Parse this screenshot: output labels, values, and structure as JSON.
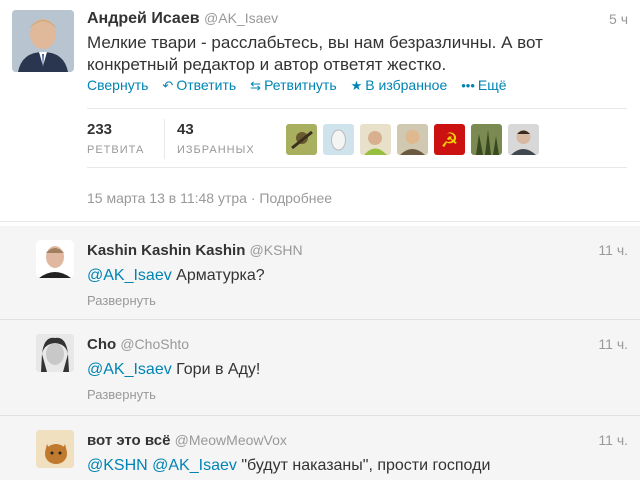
{
  "main_tweet": {
    "fullname": "Андрей Исаев",
    "username": "@AK_Isaev",
    "time": "5 ч",
    "text": "Мелкие твари - расслабьтесь, вы нам безразличны. А вот конкретный редактор и автор ответят жестко.",
    "actions": {
      "collapse": "Свернуть",
      "reply": "Ответить",
      "retweet": "Ретвитнуть",
      "favorite": "В избранное",
      "more": "Ещё"
    },
    "stats": {
      "retweets_count": "233",
      "retweets_label": "РЕТВИТА",
      "favorites_count": "43",
      "favorites_label": "ИЗБРАННЫХ"
    },
    "timestamp": "15 марта 13 в 11:48 утра",
    "separator": "·",
    "details_link": "Подробнее"
  },
  "replies": [
    {
      "fullname": "Kashin Kashin Kashin",
      "username": "@KSHN",
      "time": "11 ч.",
      "mentions": "@AK_Isaev",
      "text": " Арматурка?",
      "expand": "Развернуть"
    },
    {
      "fullname": "Cho",
      "username": "@ChoShto",
      "time": "11 ч.",
      "mentions": "@AK_Isaev",
      "text": " Гори в Аду!",
      "expand": "Развернуть"
    },
    {
      "fullname": "вот это всё",
      "username": "@MeowMeowVox",
      "time": "11 ч.",
      "mentions": "@KSHN @AK_Isaev",
      "text": " \"будут наказаны\", прости господи",
      "expand": ""
    }
  ],
  "colors": {
    "link": "#0084b4",
    "muted": "#999999",
    "reply_bg": "#f5f5f5"
  }
}
